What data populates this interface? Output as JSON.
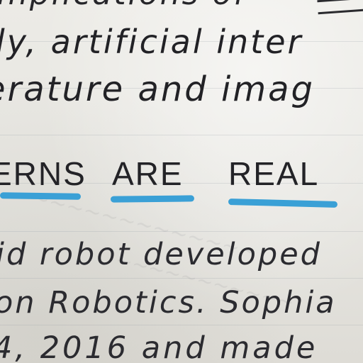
{
  "document": {
    "lines_top": [
      "mplications of",
      "ly, artificial inter",
      "erature and imag"
    ],
    "heading_words": [
      "ERNS",
      "ARE",
      "REAL"
    ],
    "lines_body": [
      "id robot developed",
      "on Robotics. Sophia",
      "4, 2016 and made"
    ]
  },
  "colors": {
    "ink": "#232327",
    "underline": "#3aa0d6",
    "paper": "#e9e8e4"
  }
}
